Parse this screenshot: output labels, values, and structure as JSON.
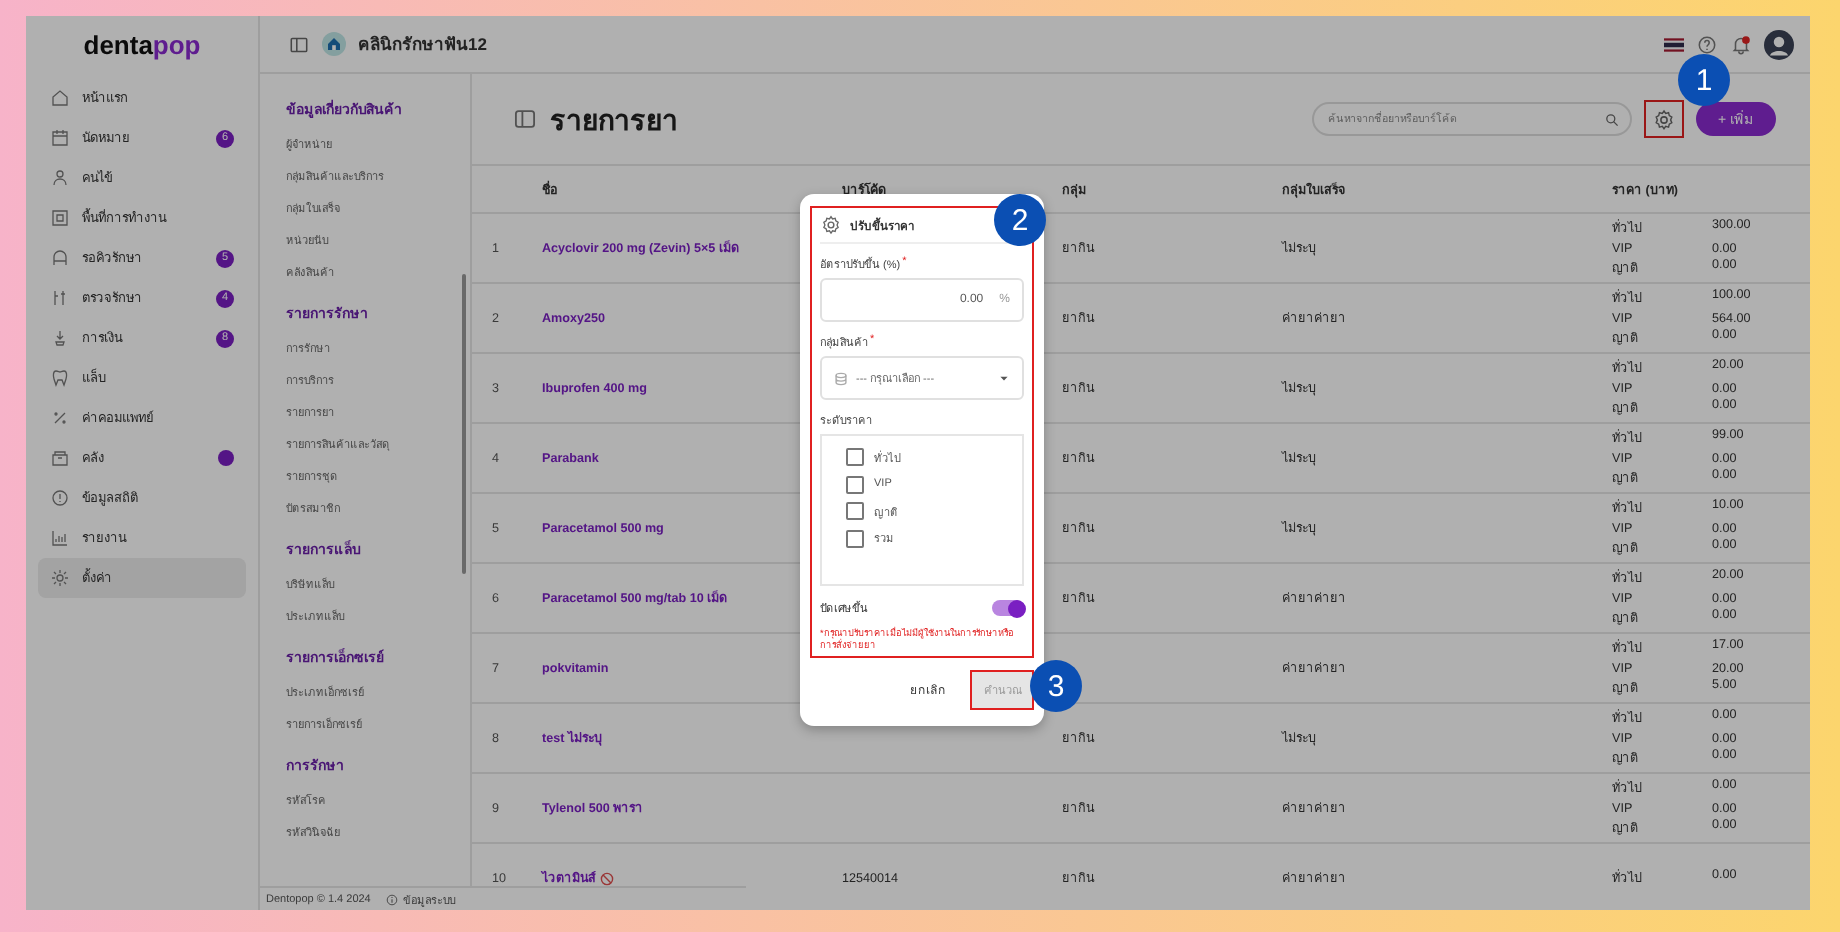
{
  "logo": {
    "first": "denta",
    "second": "pop"
  },
  "sidebar": {
    "items": [
      {
        "label": "หน้าแรก",
        "selected": false
      },
      {
        "label": "นัดหมาย",
        "badge": "6",
        "selected": false
      },
      {
        "label": "คนไข้",
        "selected": false
      },
      {
        "label": "พื้นที่การทำงาน",
        "selected": false
      },
      {
        "label": "รอคิวรักษา",
        "badge": "5",
        "selected": false
      },
      {
        "label": "ตรวจรักษา",
        "badge": "4",
        "selected": false
      },
      {
        "label": "การเงิน",
        "badge": "8",
        "selected": false
      },
      {
        "label": "แล็บ",
        "selected": false
      },
      {
        "label": "ค่าคอมแพทย์",
        "selected": false
      },
      {
        "label": "คลัง",
        "dot": true,
        "selected": false
      },
      {
        "label": "ข้อมูลสถิติ",
        "selected": false
      },
      {
        "label": "รายงาน",
        "selected": false
      },
      {
        "label": "ตั้งค่า",
        "selected": true
      }
    ]
  },
  "header": {
    "clinic": "คลินิกรักษาฟัน12"
  },
  "submenu": {
    "sections": [
      {
        "title": "ข้อมูลเกี่ยวกับสินค้า",
        "items": [
          "ผู้จำหน่าย",
          "กลุ่มสินค้าและบริการ",
          "กลุ่มใบเสร็จ",
          "หน่วยนับ",
          "คลังสินค้า"
        ]
      },
      {
        "title": "รายการรักษา",
        "items": [
          "การรักษา",
          "การบริการ",
          "รายการยา",
          "รายการสินค้าและวัสดุ",
          "รายการชุด",
          "บัตรสมาชิก"
        ]
      },
      {
        "title": "รายการแล็บ",
        "items": [
          "บริษัทแล็บ",
          "ประเภทแล็บ"
        ]
      },
      {
        "title": "รายการเอ็กซเรย์",
        "items": [
          "ประเภทเอ็กซเรย์",
          "รายการเอ็กซเรย์"
        ]
      },
      {
        "title": "การรักษา",
        "items": [
          "รหัสโรค",
          "รหัสวินิจฉัย"
        ]
      }
    ]
  },
  "footer": {
    "version": "Dentopop © 1.4 2024",
    "info": "ข้อมูลระบบ"
  },
  "page": {
    "title": "รายการยา",
    "search": {
      "placeholder": "ค้นหาจากชื่อยาหรือบาร์โค้ด"
    },
    "add_button": "+ เพิ่ม"
  },
  "table": {
    "columns": [
      "ชื่อ",
      "บาร์โค้ด",
      "กลุ่ม",
      "กลุ่มใบเสร็จ",
      "ราคา (บาท)"
    ],
    "rows": [
      {
        "no": "1",
        "name": "Acyclovir 200 mg (Zevin) 5×5 เม็ด",
        "group": "ยากิน",
        "receipt": "ไม่ระบุ",
        "prices": [
          {
            "tier": "ทั่วไป",
            "value": "300.00"
          },
          {
            "tier": "VIP",
            "value": "0.00"
          },
          {
            "tier": "ญาติ",
            "value": "0.00"
          }
        ]
      },
      {
        "no": "2",
        "name": "Amoxy250",
        "group": "ยากิน",
        "receipt": "ค่ายาค่ายา",
        "prices": [
          {
            "tier": "ทั่วไป",
            "value": "100.00"
          },
          {
            "tier": "VIP",
            "value": "564.00"
          },
          {
            "tier": "ญาติ",
            "value": "0.00"
          }
        ]
      },
      {
        "no": "3",
        "name": "Ibuprofen 400 mg",
        "group": "ยากิน",
        "receipt": "ไม่ระบุ",
        "prices": [
          {
            "tier": "ทั่วไป",
            "value": "20.00"
          },
          {
            "tier": "VIP",
            "value": "0.00"
          },
          {
            "tier": "ญาติ",
            "value": "0.00"
          }
        ]
      },
      {
        "no": "4",
        "name": "Parabank",
        "group": "ยากิน",
        "receipt": "ไม่ระบุ",
        "prices": [
          {
            "tier": "ทั่วไป",
            "value": "99.00"
          },
          {
            "tier": "VIP",
            "value": "0.00"
          },
          {
            "tier": "ญาติ",
            "value": "0.00"
          }
        ]
      },
      {
        "no": "5",
        "name": "Paracetamol 500 mg",
        "group": "ยากิน",
        "receipt": "ไม่ระบุ",
        "prices": [
          {
            "tier": "ทั่วไป",
            "value": "10.00"
          },
          {
            "tier": "VIP",
            "value": "0.00"
          },
          {
            "tier": "ญาติ",
            "value": "0.00"
          }
        ]
      },
      {
        "no": "6",
        "name": "Paracetamol 500 mg/tab 10 เม็ด",
        "group": "ยากิน",
        "receipt": "ค่ายาค่ายา",
        "prices": [
          {
            "tier": "ทั่วไป",
            "value": "20.00"
          },
          {
            "tier": "VIP",
            "value": "0.00"
          },
          {
            "tier": "ญาติ",
            "value": "0.00"
          }
        ]
      },
      {
        "no": "7",
        "name": "pokvitamin",
        "receipt": "ค่ายาค่ายา",
        "prices": [
          {
            "tier": "ทั่วไป",
            "value": "17.00"
          },
          {
            "tier": "VIP",
            "value": "20.00"
          },
          {
            "tier": "ญาติ",
            "value": "5.00"
          }
        ]
      },
      {
        "no": "8",
        "name": "test ไม่ระบุ",
        "group": "ยากิน",
        "receipt": "ไม่ระบุ",
        "prices": [
          {
            "tier": "ทั่วไป",
            "value": "0.00"
          },
          {
            "tier": "VIP",
            "value": "0.00"
          },
          {
            "tier": "ญาติ",
            "value": "0.00"
          }
        ]
      },
      {
        "no": "9",
        "name": "Tylenol 500 พารา",
        "group": "ยากิน",
        "receipt": "ค่ายาค่ายา",
        "prices": [
          {
            "tier": "ทั่วไป",
            "value": "0.00"
          },
          {
            "tier": "VIP",
            "value": "0.00"
          },
          {
            "tier": "ญาติ",
            "value": "0.00"
          }
        ]
      },
      {
        "no": "10",
        "name": "ไวตามินส์",
        "inactive": true,
        "barcode": "12540014",
        "group": "ยากิน",
        "receipt": "ค่ายาค่ายา",
        "prices": [
          {
            "tier": "ทั่วไป",
            "value": "0.00"
          }
        ]
      }
    ]
  },
  "dialog": {
    "title": "ปรับขึ้นราคา",
    "rate": {
      "label": "อัตราปรับขึ้น (%)",
      "required_mark": "*",
      "value": "0.00",
      "suffix": "%"
    },
    "group": {
      "label": "กลุ่มสินค้า",
      "required_mark": "*",
      "placeholder": "--- กรุณาเลือก ---"
    },
    "levels": {
      "label": "ระดับราคา",
      "options": [
        {
          "label": "ทั่วไป",
          "checked": false
        },
        {
          "label": "VIP",
          "checked": false
        },
        {
          "label": "ญาติ",
          "checked": false
        },
        {
          "label": "รวม",
          "checked": false
        }
      ]
    },
    "round_up": {
      "label": "ปัดเศษขึ้น",
      "on": true
    },
    "note": "*กรุณาปรับราคาเมื่อไม่มีผู้ใช้งานในการรักษาหรือการสั่งจ่ายยา",
    "cancel": "ยกเลิก",
    "calculate": {
      "label": "คำนวณ",
      "disabled": true
    }
  },
  "callouts": [
    "1",
    "2",
    "3"
  ]
}
